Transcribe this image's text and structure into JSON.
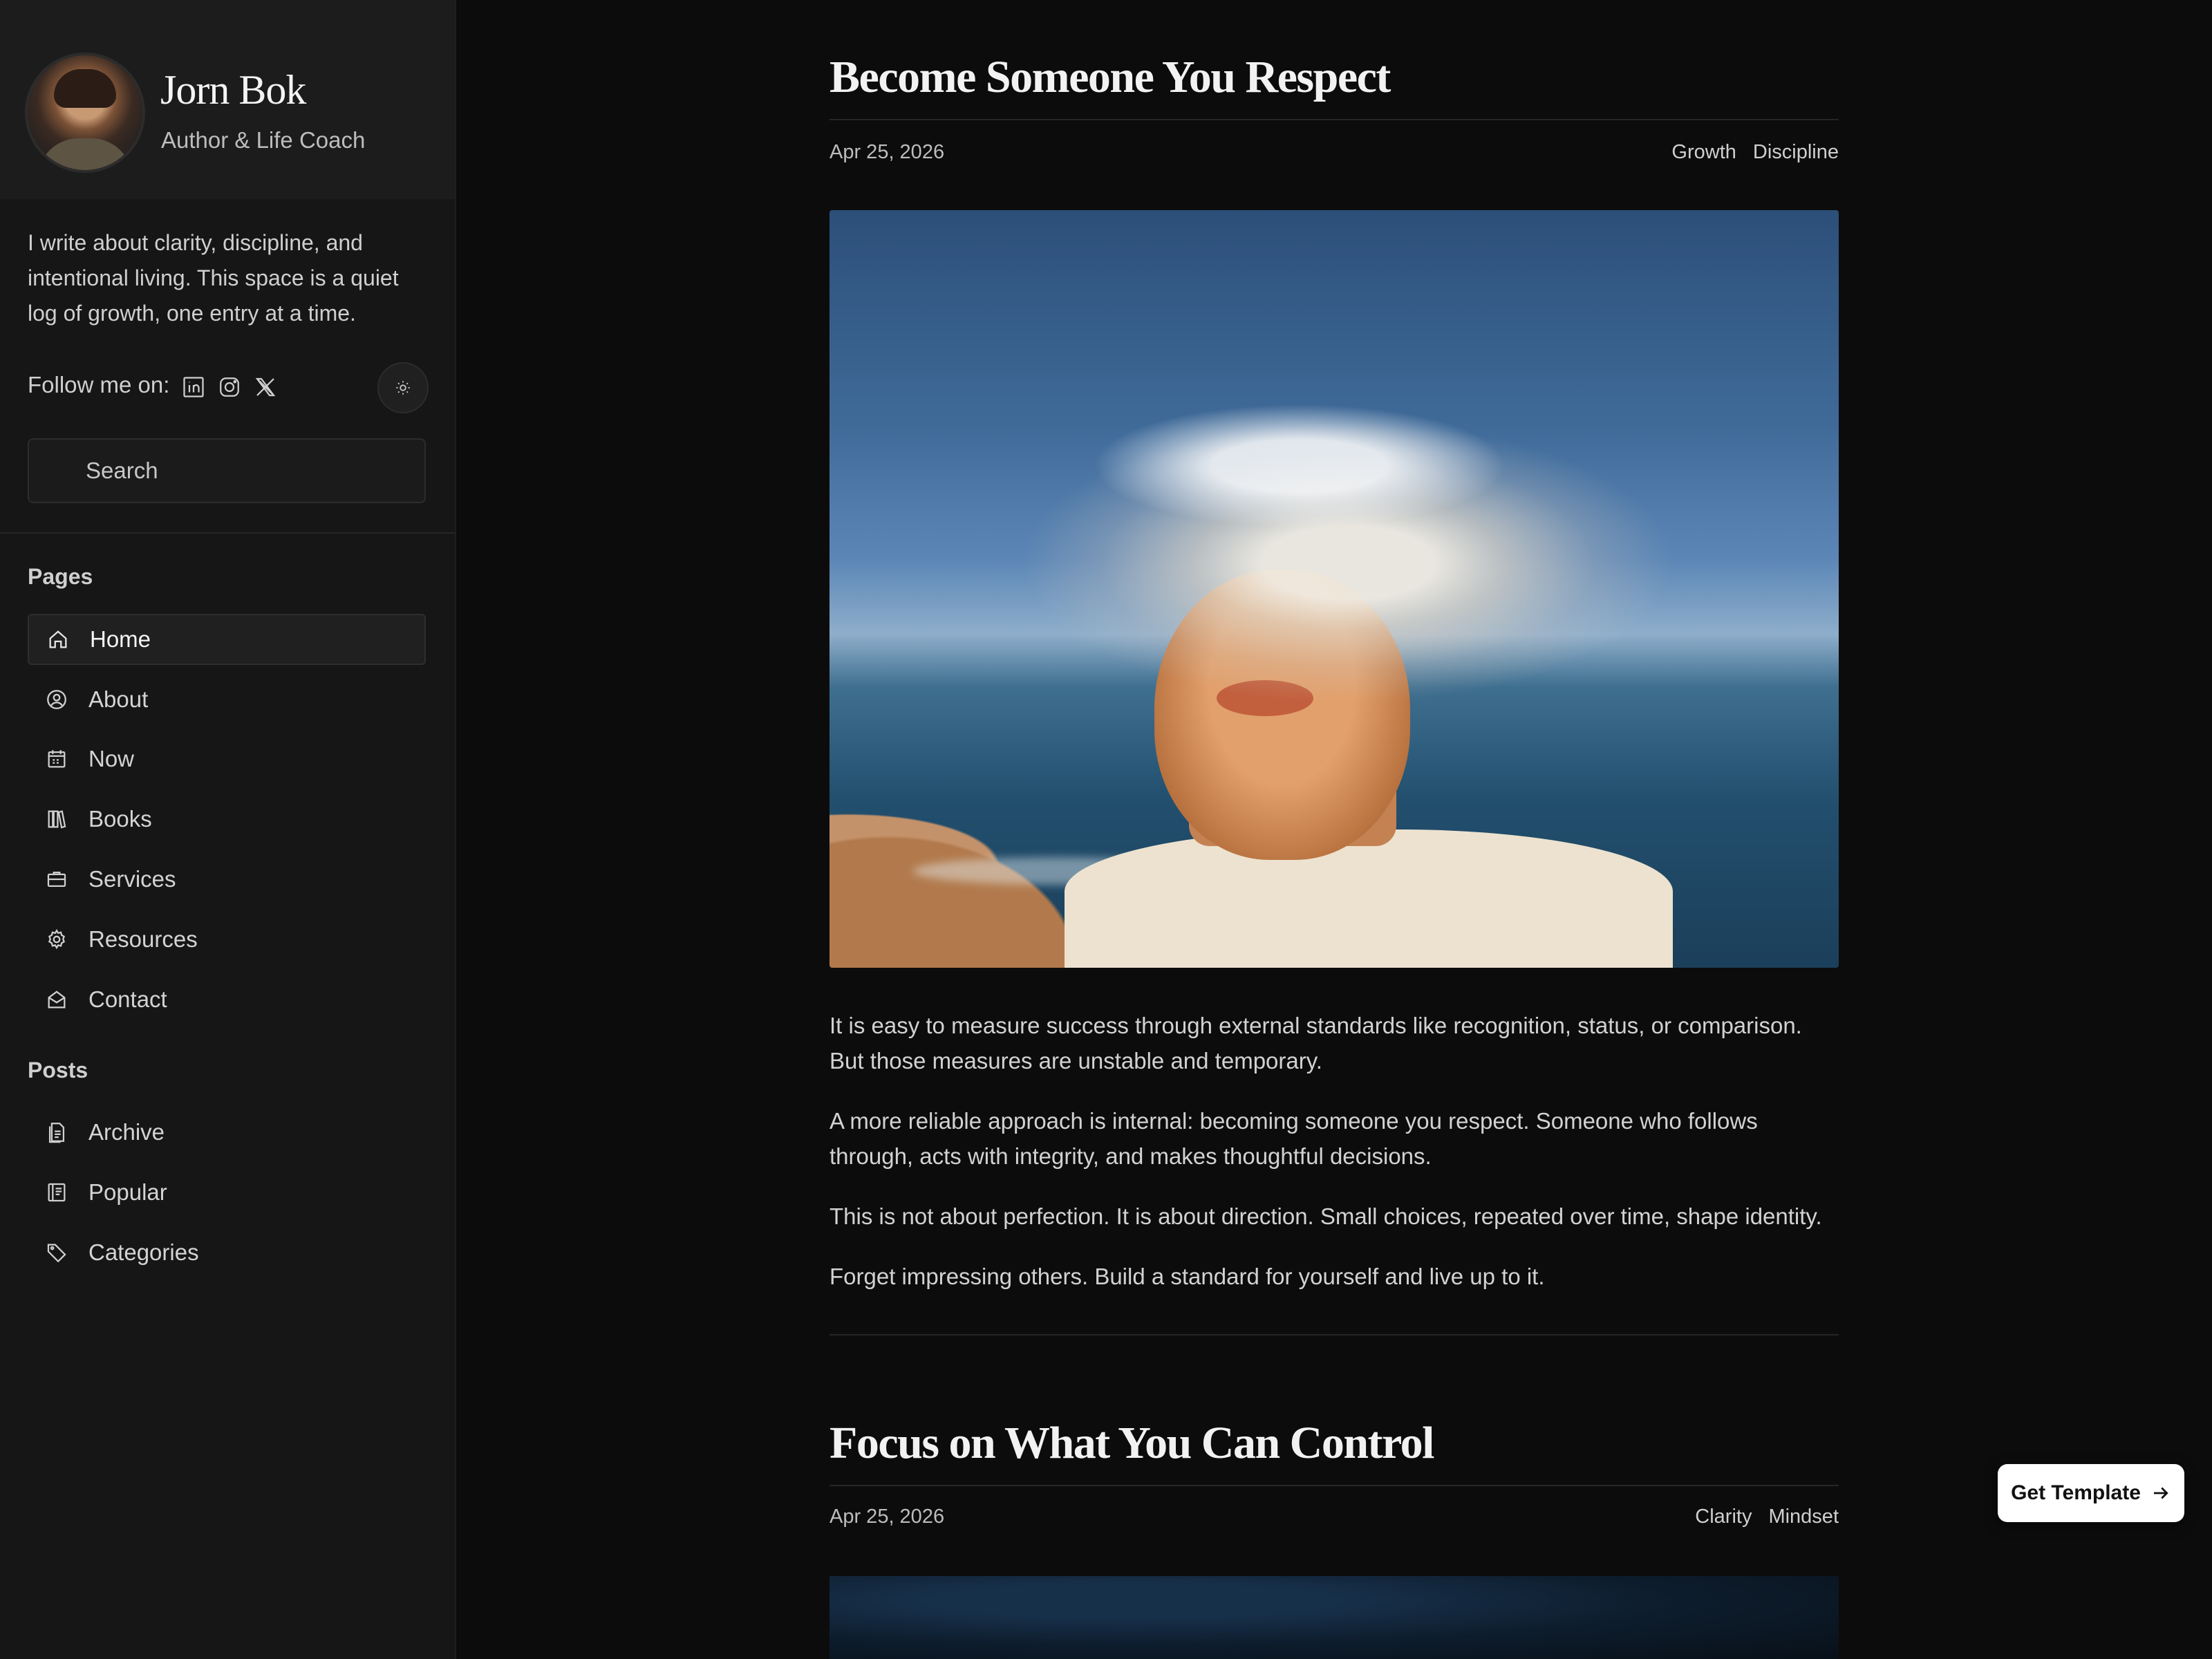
{
  "profile": {
    "name": "Jorn Bok",
    "role": "Author & Life Coach",
    "bio": "I write about clarity, discipline, and intentional living. This space is a quiet log of growth, one entry at a time.",
    "follow_label": "Follow me on:",
    "social": [
      "linkedin-icon",
      "instagram-icon",
      "x-icon"
    ]
  },
  "search": {
    "placeholder": "Search"
  },
  "nav": {
    "pages_heading": "Pages",
    "pages": [
      {
        "label": "Home",
        "icon": "home-icon",
        "active": true
      },
      {
        "label": "About",
        "icon": "user-circle-icon"
      },
      {
        "label": "Now",
        "icon": "calendar-icon"
      },
      {
        "label": "Books",
        "icon": "books-icon"
      },
      {
        "label": "Services",
        "icon": "briefcase-icon"
      },
      {
        "label": "Resources",
        "icon": "gear-icon"
      },
      {
        "label": "Contact",
        "icon": "mail-icon"
      }
    ],
    "posts_heading": "Posts",
    "posts": [
      {
        "label": "Archive",
        "icon": "archive-icon"
      },
      {
        "label": "Popular",
        "icon": "document-icon"
      },
      {
        "label": "Categories",
        "icon": "tag-icon"
      }
    ]
  },
  "posts": [
    {
      "title": "Become Someone You Respect",
      "date": "Apr 25, 2026",
      "tags": [
        "Growth",
        "Discipline"
      ],
      "paragraphs": [
        "It is easy to measure success through external standards like recognition, status, or comparison. But those measures are unstable and temporary.",
        "A more reliable approach is internal: becoming someone you respect. Someone who follows through, acts with integrity, and makes thoughtful decisions.",
        "This is not about perfection. It is about direction. Small choices, repeated over time, shape identity.",
        "Forget impressing others. Build a standard for yourself and live up to it."
      ]
    },
    {
      "title": "Focus on What You Can Control",
      "date": "Apr 25, 2026",
      "tags": [
        "Clarity",
        "Mindset"
      ]
    }
  ],
  "cta": {
    "label": "Get Template"
  }
}
